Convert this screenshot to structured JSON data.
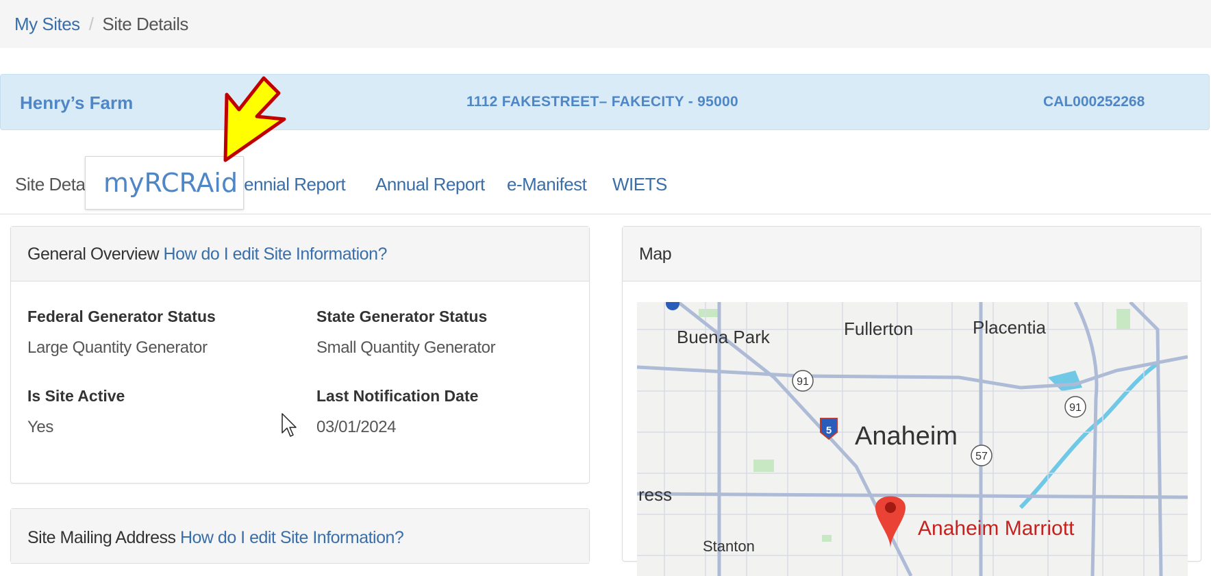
{
  "breadcrumb": {
    "root": "My Sites",
    "separator": "/",
    "current": "Site Details"
  },
  "site": {
    "name": "Henry’s Farm",
    "address": "1112 FAKESTREET– FAKECITY - 95000",
    "epa_id": "CAL000252268"
  },
  "tabs": [
    {
      "label": "Site Details",
      "active": true
    },
    {
      "label": "Biennial Report",
      "active": false
    },
    {
      "label": "Annual Report",
      "active": false
    },
    {
      "label": "e-Manifest",
      "active": false
    },
    {
      "label": "WIETS",
      "active": false
    }
  ],
  "callout": {
    "text": "myRCRAid",
    "arrow_color": "#ffff00",
    "arrow_border": "#c00000"
  },
  "overview": {
    "title": "General Overview",
    "help_link": "How do I edit Site Information?",
    "fields": {
      "federal_status_label": "Federal Generator Status",
      "federal_status_value": "Large Quantity Generator",
      "state_status_label": "State Generator Status",
      "state_status_value": "Small Quantity Generator",
      "site_active_label": "Is Site Active",
      "site_active_value": "Yes",
      "notification_label": "Last Notification Date",
      "notification_value": "03/01/2024"
    }
  },
  "mailing": {
    "title": "Site Mailing Address",
    "help_link": "How do I edit Site Information?"
  },
  "map": {
    "title": "Map",
    "labels": {
      "buena_park": "Buena Park",
      "fullerton": "Fullerton",
      "placentia": "Placentia",
      "anaheim": "Anaheim",
      "ress": "ress",
      "stanton": "Stanton",
      "marriott": "Anaheim Marriott",
      "hwy91a": "91",
      "hwy91b": "91",
      "hwy57": "57",
      "i5": "5"
    },
    "colors": {
      "road": "#aebbd6",
      "water": "#6fc8e6",
      "park": "#c8e8c4",
      "pin": "#ea4335"
    }
  }
}
